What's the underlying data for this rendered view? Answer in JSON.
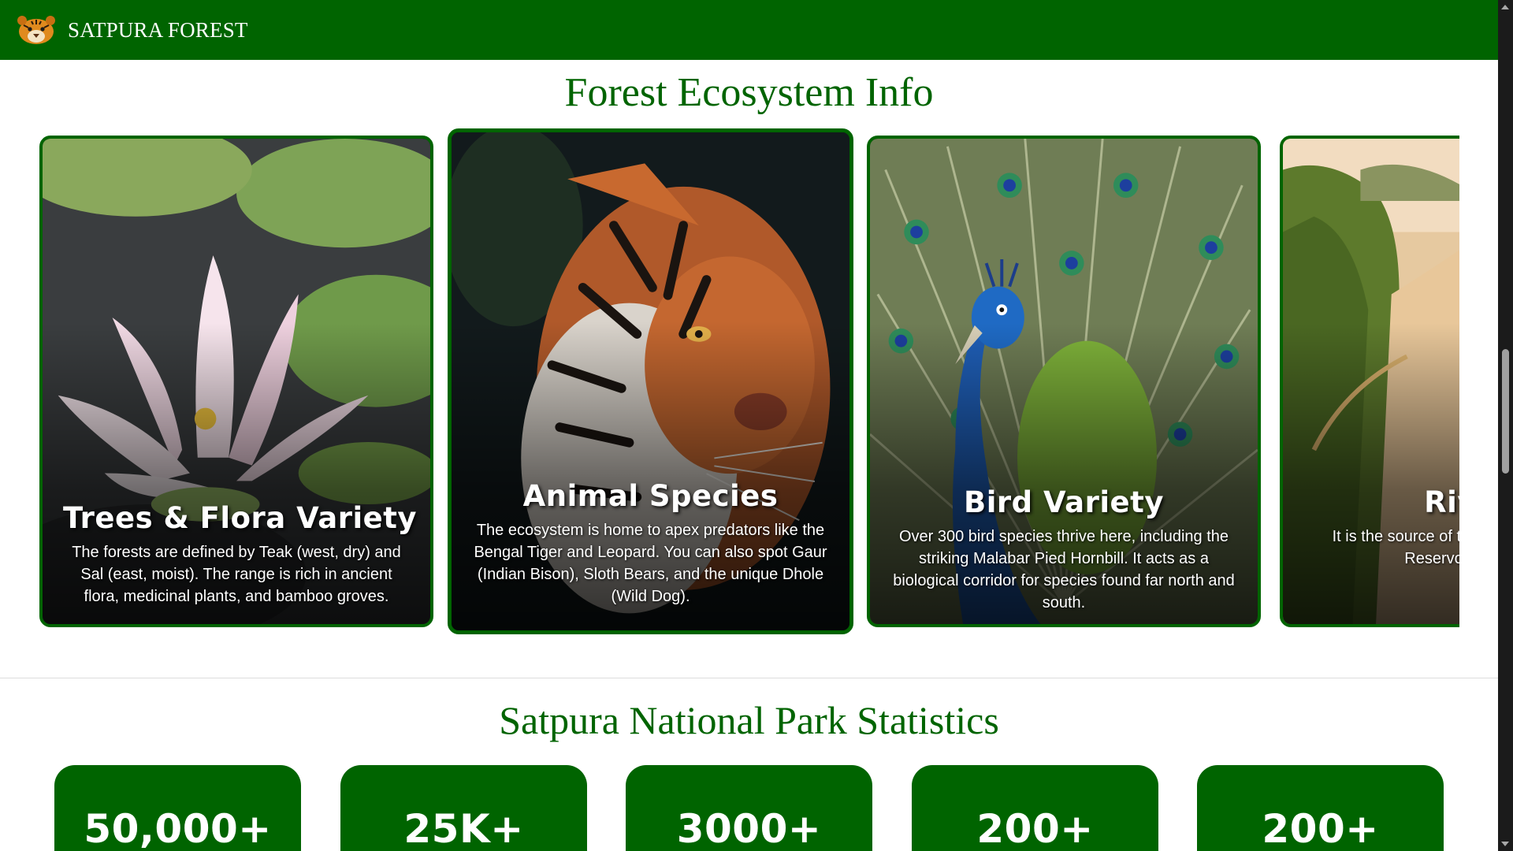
{
  "nav": {
    "brand": "SATPURA FOREST",
    "logo_icon": "tiger-face-icon"
  },
  "ecosystem": {
    "title": "Forest Ecosystem Info",
    "cards": [
      {
        "title": "Trees & Flora Variety",
        "description": "The forests are defined by Teak (west, dry) and Sal (east, moist). The range is rich in ancient flora, medicinal plants, and bamboo groves.",
        "image": "water-lily"
      },
      {
        "title": "Animal Species",
        "description": "The ecosystem is home to apex predators like the Bengal Tiger and Leopard. You can also spot Gaur (Indian Bison), Sloth Bears, and the unique Dhole (Wild Dog).",
        "image": "bengal-tiger"
      },
      {
        "title": "Bird Variety",
        "description": "Over 300 bird species thrive here, including the striking Malabar Pied Hornbill. It acts as a biological corridor for species found far north and south.",
        "image": "peacock"
      },
      {
        "title": "Rivers",
        "description": "It is the source of the Tapti rivers. Water s Reservoir and cou st",
        "image": "river-valley"
      }
    ]
  },
  "statistics": {
    "title": "Satpura National Park Statistics",
    "items": [
      {
        "value": "50,000+"
      },
      {
        "value": "25K+"
      },
      {
        "value": "3000+"
      },
      {
        "value": "200+"
      },
      {
        "value": "200+"
      }
    ]
  },
  "colors": {
    "brand_green": "#006400",
    "text_white": "#ffffff"
  }
}
